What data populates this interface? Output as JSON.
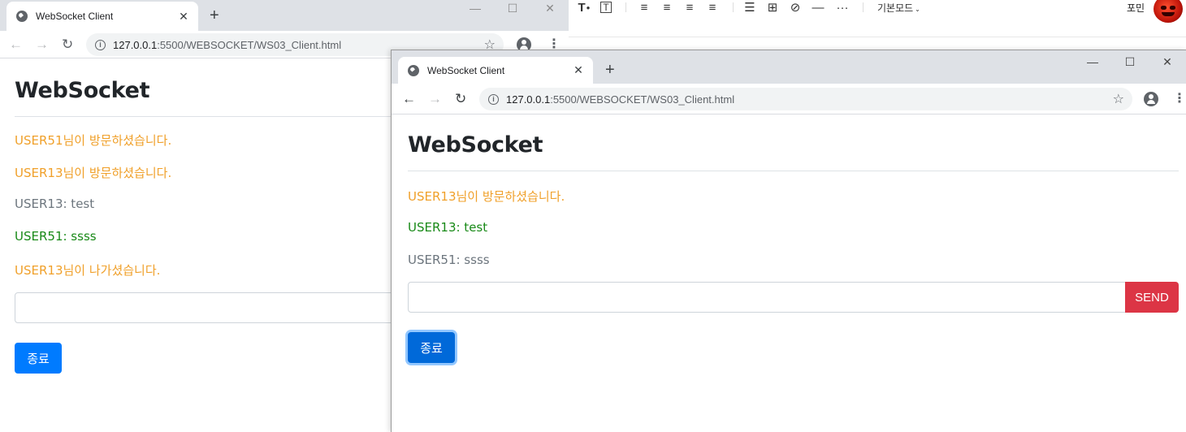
{
  "editor_toolbar": {
    "items": [
      {
        "icon": "text-color-icon",
        "glyph": "T●"
      },
      {
        "icon": "text-box-icon",
        "glyph": "T"
      },
      {
        "icon": "align-left-icon",
        "glyph": "≡"
      },
      {
        "icon": "align-center-icon",
        "glyph": "≡"
      },
      {
        "icon": "align-right-icon",
        "glyph": "≡"
      },
      {
        "icon": "align-justify-icon",
        "glyph": "≡"
      },
      {
        "icon": "list-icon",
        "glyph": "☰"
      },
      {
        "icon": "table-icon",
        "glyph": "⊞"
      },
      {
        "icon": "link-icon",
        "glyph": "⊘"
      },
      {
        "icon": "horizontal-line-icon",
        "glyph": "—"
      },
      {
        "icon": "more-icon",
        "glyph": "···"
      }
    ],
    "mode_label": "기본모드",
    "user_name": "포민"
  },
  "back_window": {
    "tab_title": "WebSocket Client",
    "tab_close": "✕",
    "new_tab": "+",
    "controls": {
      "minimize": "—",
      "maximize": "☐",
      "close": "✕"
    },
    "url_host": "127.0.0.1",
    "url_path": ":5500/WEBSOCKET/WS03_Client.html",
    "heading": "WebSocket",
    "messages": [
      {
        "text": "USER51님이 방문하셨습니다.",
        "type": "orange"
      },
      {
        "text": "USER13님이 방문하셨습니다.",
        "type": "orange"
      },
      {
        "text": "USER13: test",
        "type": "grey"
      },
      {
        "text": "USER51: ssss",
        "type": "green"
      },
      {
        "text": "USER13님이 나가셨습니다.",
        "type": "orange"
      }
    ],
    "end_button": "종료"
  },
  "front_window": {
    "tab_title": "WebSocket Client",
    "tab_close": "✕",
    "new_tab": "+",
    "controls": {
      "minimize": "—",
      "maximize": "☐",
      "close": "✕"
    },
    "url_host": "127.0.0.1",
    "url_path": ":5500/WEBSOCKET/WS03_Client.html",
    "heading": "WebSocket",
    "messages": [
      {
        "text": "USER13님이 방문하셨습니다.",
        "type": "orange"
      },
      {
        "text": "USER13: test",
        "type": "green"
      },
      {
        "text": "USER51: ssss",
        "type": "grey"
      }
    ],
    "input_value": "",
    "send_button": "SEND",
    "end_button": "종료"
  },
  "colors": {
    "join_message": "#f0a02a",
    "own_message": "#198a18",
    "other_message": "#6c757d",
    "send_button": "#dc3545",
    "end_button": "#007bff"
  }
}
